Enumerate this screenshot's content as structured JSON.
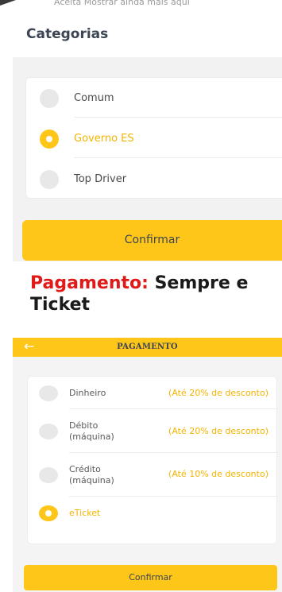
{
  "top_strip": {
    "faded_text": "Aceita Mostrar ainda mais aqui"
  },
  "categories": {
    "heading": "Categorias",
    "options": [
      {
        "label": "Comum",
        "selected": false
      },
      {
        "label": "Governo ES",
        "selected": true
      },
      {
        "label": "Top Driver",
        "selected": false
      }
    ],
    "confirm_label": "Confirmar"
  },
  "caption": {
    "accent": "Pagamento:",
    "line1_rest": " Sempre e",
    "line2": "Ticket"
  },
  "payment": {
    "back_glyph": "←",
    "title": "PAGAMENTO",
    "options": [
      {
        "label": "Dinheiro",
        "discount": "(Até 20% de desconto)",
        "selected": false
      },
      {
        "label": "Débito\n(máquina)",
        "discount": "(Até 20% de desconto)",
        "selected": false
      },
      {
        "label": "Crédito\n(máquina)",
        "discount": "(Até 10% de desconto)",
        "selected": false
      },
      {
        "label": "eTicket",
        "discount": "",
        "selected": true
      }
    ],
    "confirm_label": "Confirmar"
  },
  "colors": {
    "accent_yellow": "#ffc61a",
    "selected_text": "#f5b400",
    "caption_red": "#e01919"
  }
}
